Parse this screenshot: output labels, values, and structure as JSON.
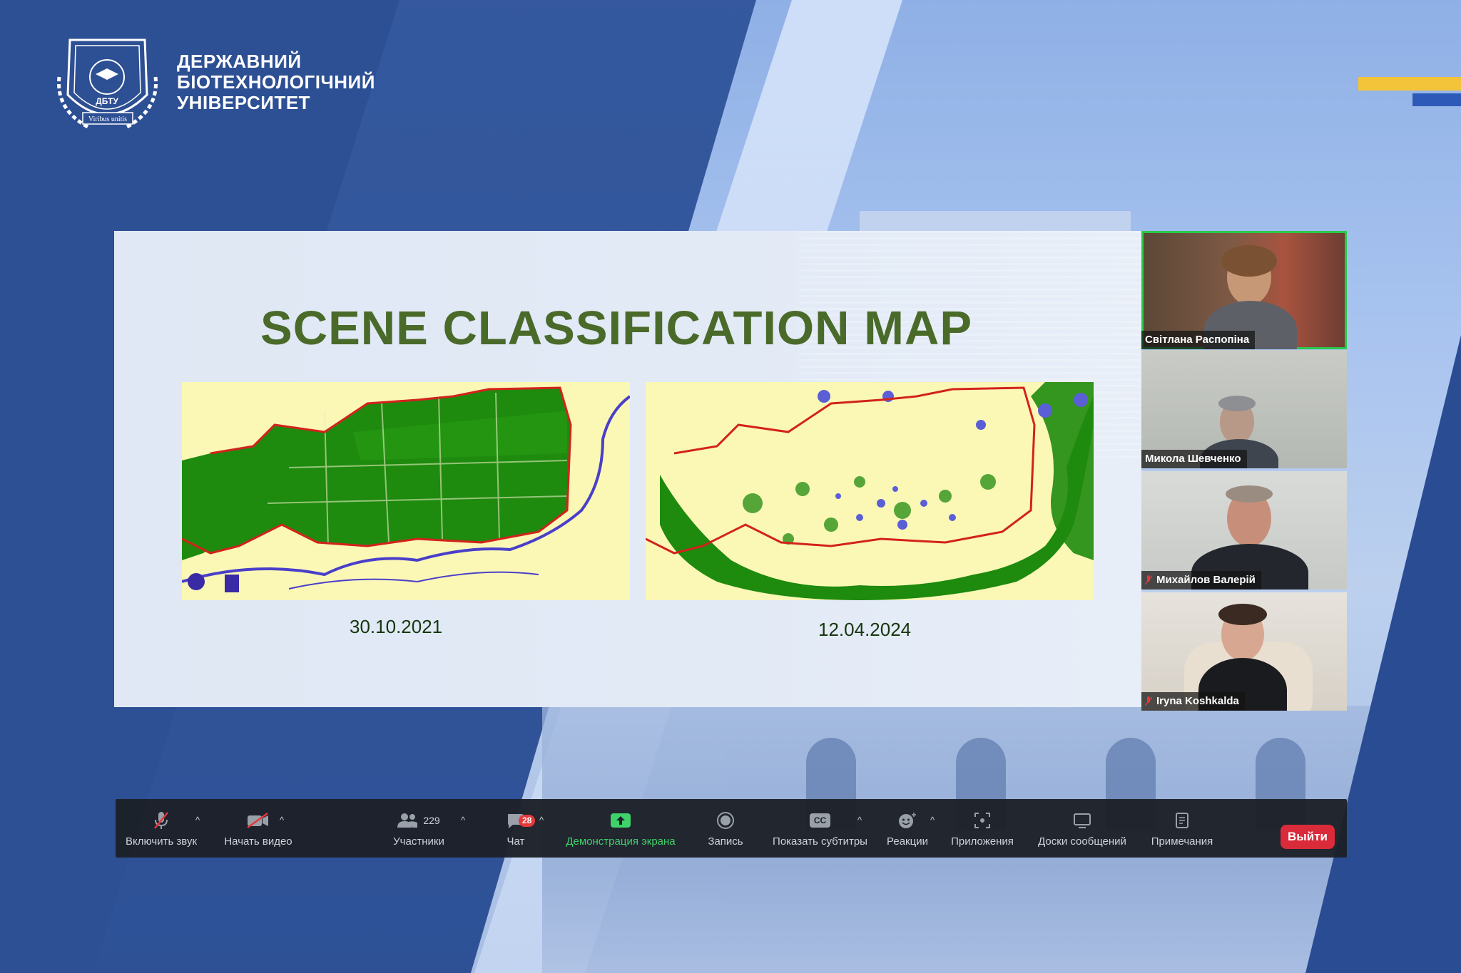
{
  "branding": {
    "university_line1": "ДЕРЖАВНИЙ",
    "university_line2": "БІОТЕХНОЛОГІЧНИЙ",
    "university_line3": "УНІВЕРСИТЕТ",
    "logo_text_ring": "ДЕРЖАВНИЙ БІОТЕХНОЛОГІЧНИЙ УНІВЕРСИТЕТ",
    "logo_abbr": "ДБТУ",
    "logo_motto": "Viribus unitis"
  },
  "slide": {
    "title": "SCENE CLASSIFICATION MAP",
    "maps": [
      {
        "date": "30.10.2021"
      },
      {
        "date": "12.04.2024"
      }
    ]
  },
  "participants": [
    {
      "name": "Світлана Распопіна",
      "muted": false,
      "active": true
    },
    {
      "name": "Микола Шевченко",
      "muted": false,
      "active": false
    },
    {
      "name": "Михайлов Валерій",
      "muted": true,
      "active": false
    },
    {
      "name": "Iryna Koshkalda",
      "muted": true,
      "active": false
    }
  ],
  "toolbar": {
    "unmute": "Включить звук",
    "start_video": "Начать видео",
    "participants_label": "Участники",
    "participants_count": "229",
    "chat": "Чат",
    "chat_badge": "28",
    "share_screen": "Демонстрация экрана",
    "record": "Запись",
    "captions": "Показать субтитры",
    "captions_icon": "CC",
    "reactions": "Реакции",
    "apps": "Приложения",
    "whiteboards": "Доски сообщений",
    "notes": "Примечания",
    "leave": "Выйти"
  },
  "colors": {
    "map_background": "#fbf8b6",
    "vegetation": "#1e8a0e",
    "boundary": "#d3221c",
    "water": "#5a5fd6",
    "title_green": "#4a6a2a",
    "share_green": "#3fd16a",
    "leave_red": "#d92b3a",
    "flag_yellow": "#f3c33a",
    "flag_blue": "#2d59b8"
  }
}
